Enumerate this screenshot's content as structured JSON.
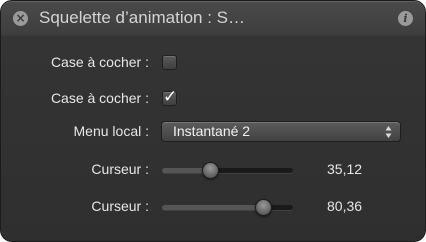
{
  "window": {
    "title": "Squelette d’animation : S…"
  },
  "rows": [
    {
      "label": "Case à cocher :",
      "checked": false
    },
    {
      "label": "Case à cocher :",
      "checked": true,
      "checkmark": "✓"
    }
  ],
  "popup": {
    "label": "Menu local :",
    "value": "Instantané 2"
  },
  "sliders": [
    {
      "label": "Curseur :",
      "value": "35,12",
      "fraction": 0.37
    },
    {
      "label": "Curseur :",
      "value": "80,36",
      "fraction": 0.77
    }
  ],
  "colors": {
    "panel": "#2f2f2f",
    "text": "#e6e6e6",
    "title": "#d4d4d4"
  },
  "icons": {
    "close": "close-icon",
    "info": "info-icon",
    "popup_arrows": "up-down-arrows-icon"
  }
}
